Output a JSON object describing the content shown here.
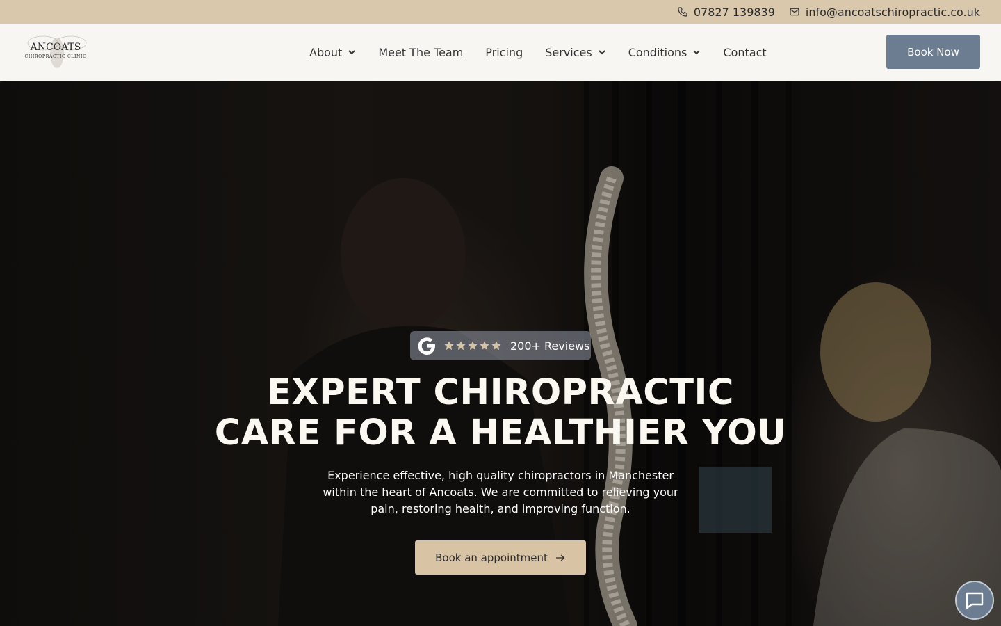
{
  "topbar": {
    "phone": "07827 139839",
    "email": "info@ancoatschiropractic.co.uk",
    "background": "#d9c8ac"
  },
  "logo": {
    "name": "ANCOATS",
    "tagline": "CHIROPRACTIC CLINIC"
  },
  "nav": {
    "items": [
      {
        "label": "About",
        "dropdown": true
      },
      {
        "label": "Meet The Team",
        "dropdown": false
      },
      {
        "label": "Pricing",
        "dropdown": false
      },
      {
        "label": "Services",
        "dropdown": true
      },
      {
        "label": "Conditions",
        "dropdown": true
      },
      {
        "label": "Contact",
        "dropdown": false
      }
    ],
    "book_label": "Book Now",
    "book_color": "#6c7d92"
  },
  "hero": {
    "reviews_label": "200+ Reviews",
    "star_count": 5,
    "headline_line1": "EXPERT CHIROPRACTIC",
    "headline_line2": "CARE FOR A HEALTHIER YOU",
    "subtext": "Experience effective, high quality chiropractors in Manchester within the heart of Ancoats. We are committed to relieving your pain, restoring health, and improving function.",
    "cta_label": "Book an appointment",
    "cta_color": "#d9c3a5"
  },
  "icons": {
    "phone": "phone-icon",
    "email": "mail-icon",
    "google": "google-icon",
    "star": "star-icon",
    "arrow": "arrow-right-icon",
    "chat": "chat-icon"
  }
}
